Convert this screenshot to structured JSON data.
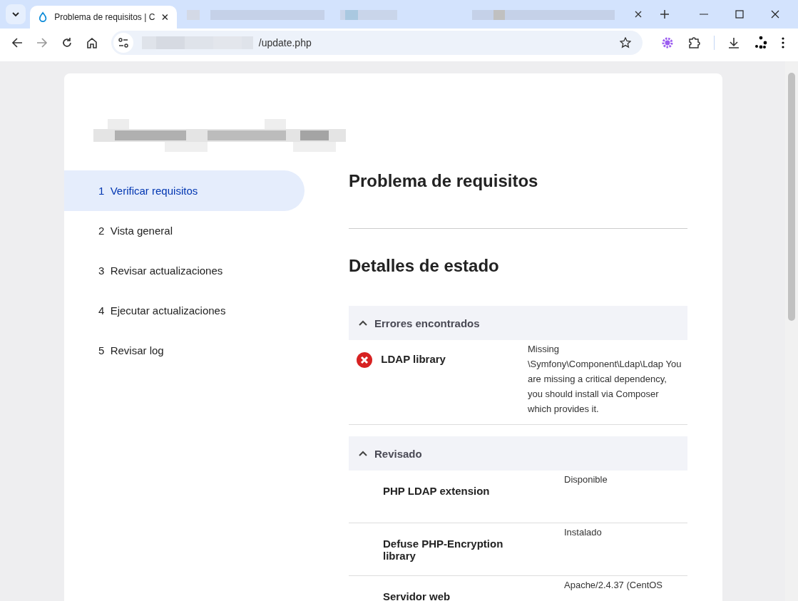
{
  "browser": {
    "tabs": [
      {
        "title": "Problema de requisitos | C",
        "selected": true
      }
    ],
    "url": "/update.php"
  },
  "steps": [
    {
      "number": "1",
      "label": "Verificar requisitos",
      "selected": true
    },
    {
      "number": "2",
      "label": "Vista general",
      "selected": false
    },
    {
      "number": "3",
      "label": "Revisar actualizaciones",
      "selected": false
    },
    {
      "number": "4",
      "label": "Ejecutar actualizaciones",
      "selected": false
    },
    {
      "number": "5",
      "label": "Revisar log",
      "selected": false
    }
  ],
  "title": "Problema de requisitos",
  "section_title": "Detalles de estado",
  "groups": [
    {
      "title": "Errores encontrados",
      "expanded": true,
      "items": [
        {
          "kind": "error",
          "name": "LDAP library",
          "value": "Missing \\Symfony\\Component\\Ldap\\Ldap You are missing a critical dependency, you should install via Composer which provides it."
        }
      ]
    },
    {
      "title": "Revisado",
      "expanded": true,
      "items": [
        {
          "kind": "ok",
          "name": "PHP LDAP extension",
          "value": "Disponible"
        },
        {
          "kind": "ok",
          "name": "Defuse PHP-Encryption library",
          "value": "Instalado"
        },
        {
          "kind": "ok",
          "name": "Servidor web",
          "value": "Apache/2.4.37 (CentOS"
        }
      ]
    }
  ]
}
